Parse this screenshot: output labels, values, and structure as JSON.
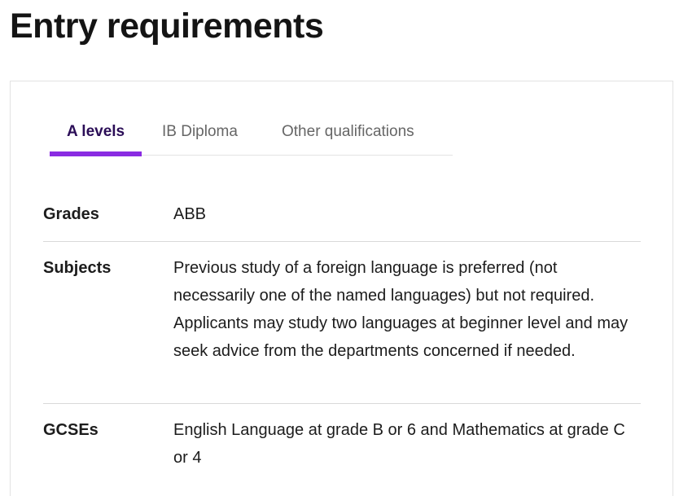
{
  "page": {
    "title": "Entry requirements"
  },
  "tabs": [
    {
      "label": "A levels",
      "active": true
    },
    {
      "label": "IB Diploma",
      "active": false
    },
    {
      "label": "Other qualifications",
      "active": false
    }
  ],
  "requirements": [
    {
      "label": "Grades",
      "value": "ABB"
    },
    {
      "label": "Subjects",
      "value": "Previous study of a foreign language is preferred (not necessarily one of the named languages) but not required. Applicants may study two languages at beginner level and may seek advice from the departments concerned if needed."
    },
    {
      "label": "GCSEs",
      "value": "English Language at grade B or 6 and Mathematics at grade C or 4"
    }
  ],
  "colors": {
    "accent": "#8a2be2",
    "active_tab_text": "#2b0e57",
    "inactive_tab_text": "#666666",
    "divider": "#d9d9d9"
  }
}
